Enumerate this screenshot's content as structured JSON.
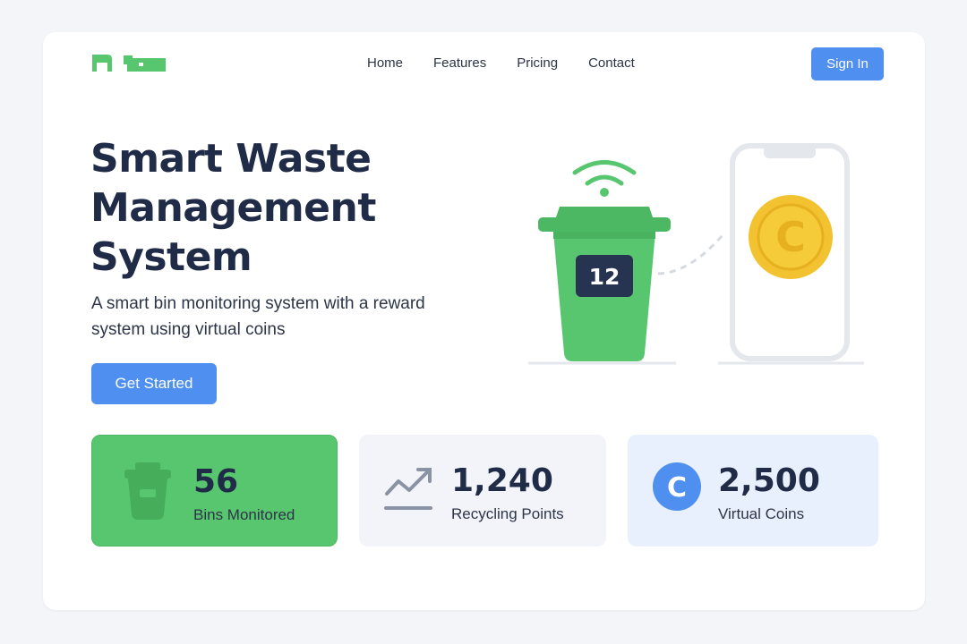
{
  "header": {
    "nav": [
      "Home",
      "Features",
      "Pricing",
      "Contact"
    ],
    "signin_label": "Sign In"
  },
  "hero": {
    "title": "Smart Waste Management System",
    "subtitle": "A smart bin monitoring system with a reward system using virtual coins",
    "cta_label": "Get Started",
    "bin_count": "12",
    "coin_symbol": "C"
  },
  "stats": [
    {
      "value": "56",
      "label": "Bins Monitored",
      "icon": "trash-bin-icon"
    },
    {
      "value": "1,240",
      "label": "Recycling Points",
      "icon": "trend-up-icon"
    },
    {
      "value": "2,500",
      "label": "Virtual Coins",
      "icon": "coin-icon"
    }
  ],
  "colors": {
    "brand_green": "#58c66f",
    "accent_blue": "#4f8ff0",
    "navy": "#1f2b47",
    "coin_gold": "#f2c230"
  }
}
